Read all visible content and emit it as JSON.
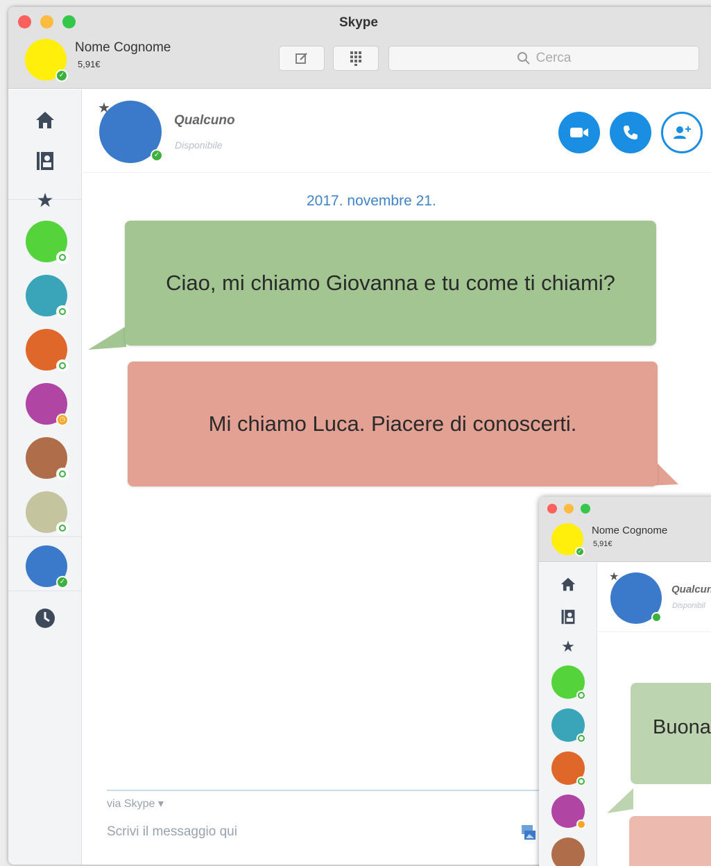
{
  "window": {
    "title": "Skype",
    "user_name": "Nome Cognome",
    "user_credit": "5,91€",
    "search_placeholder": "Cerca"
  },
  "chat": {
    "peer_name": "Qualcuno",
    "peer_status": "Disponibile",
    "date": "2017. novembre 21.",
    "messages": [
      {
        "text": "Ciao, mi chiamo Giovanna e tu come ti chiami?",
        "color": "#a2c592"
      },
      {
        "text": "Mi chiamo Luca. Piacere di conoscerti.",
        "color": "#e3a194"
      }
    ],
    "via_label": "via Skype ▾",
    "input_placeholder": "Scrivi il messaggio qui"
  },
  "contacts": [
    {
      "color": "#55d33a",
      "status": "online"
    },
    {
      "color": "#3aa5b9",
      "status": "online"
    },
    {
      "color": "#e0672a",
      "status": "online"
    },
    {
      "color": "#b045a3",
      "status": "away"
    },
    {
      "color": "#b06d4a",
      "status": "online"
    },
    {
      "color": "#c4c59f",
      "status": "online"
    },
    {
      "color": "#3b7acb",
      "status": "online-selected"
    }
  ],
  "mini_window": {
    "user_name": "Nome Cognome",
    "user_credit": "5,91€",
    "peer_name": "Qualcun",
    "peer_status": "Disponibil",
    "message_start": "Buona"
  },
  "icons": {
    "sidebar": [
      "home-icon",
      "contacts-book-icon",
      "star-icon",
      "clock-icon"
    ],
    "toolbar": [
      "compose-icon",
      "dialpad-icon",
      "search-icon"
    ],
    "header": [
      "video-call-icon",
      "phone-icon",
      "add-contact-icon"
    ]
  },
  "colors": {
    "accent": "#1a8ee3",
    "online": "#3db13d",
    "away": "#f6a623",
    "date_text": "#3f84c8"
  }
}
